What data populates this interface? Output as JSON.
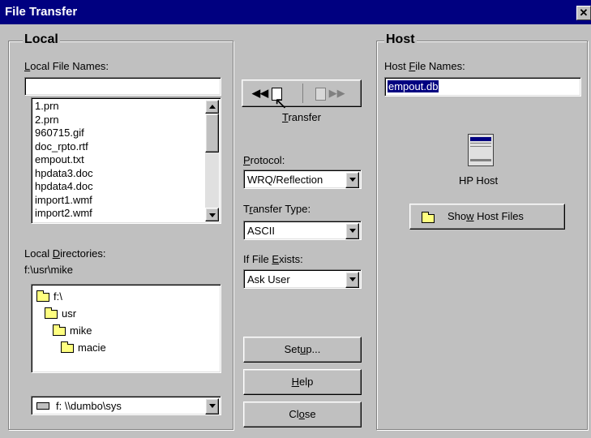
{
  "window": {
    "title": "File Transfer",
    "close_glyph": "✕"
  },
  "local": {
    "group_label": "Local",
    "file_names_label_pre": "",
    "file_names_label_u": "L",
    "file_names_label_post": "ocal File Names:",
    "file_name_value": "",
    "files": [
      "1.prn",
      "2.prn",
      "960715.gif",
      "doc_rpto.rtf",
      "empout.txt",
      "hpdata3.doc",
      "hpdata4.doc",
      "import1.wmf",
      "import2.wmf"
    ],
    "directories_label_pre": "Local ",
    "directories_label_u": "D",
    "directories_label_post": "irectories:",
    "current_path": "f:\\usr\\mike",
    "tree": [
      {
        "label": "f:\\",
        "icon": "open-folder-icon"
      },
      {
        "label": "usr",
        "icon": "open-folder-icon"
      },
      {
        "label": "mike",
        "icon": "open-folder-icon"
      },
      {
        "label": "macie",
        "icon": "folder-icon"
      }
    ],
    "drive_value": "f:  \\\\dumbo\\sys"
  },
  "middle": {
    "transfer_label_pre": "",
    "transfer_label_u": "T",
    "transfer_label_post": "ransfer",
    "protocol_label_pre": "",
    "protocol_label_u": "P",
    "protocol_label_post": "rotocol:",
    "protocol_value": "WRQ/Reflection",
    "transfer_type_label_pre": "T",
    "transfer_type_label_u": "r",
    "transfer_type_label_post": "ansfer Type:",
    "transfer_type_value": "ASCII",
    "if_exists_label_pre": "If File ",
    "if_exists_label_u": "E",
    "if_exists_label_post": "xists:",
    "if_exists_value": "Ask User",
    "setup_pre": "Set",
    "setup_u": "u",
    "setup_post": "p...",
    "help_pre": "",
    "help_u": "H",
    "help_post": "elp",
    "close_pre": "Cl",
    "close_u": "o",
    "close_post": "se"
  },
  "host": {
    "group_label": "Host",
    "file_names_label_pre": "Host ",
    "file_names_label_u": "F",
    "file_names_label_post": "ile Names:",
    "file_name_value": "empout.db",
    "host_icon_label": "HP Host",
    "show_files_pre": "Sho",
    "show_files_u": "w",
    "show_files_post": " Host Files"
  },
  "colors": {
    "title_bar": "#000080",
    "face": "#c0c0c0",
    "selection": "#000080"
  }
}
